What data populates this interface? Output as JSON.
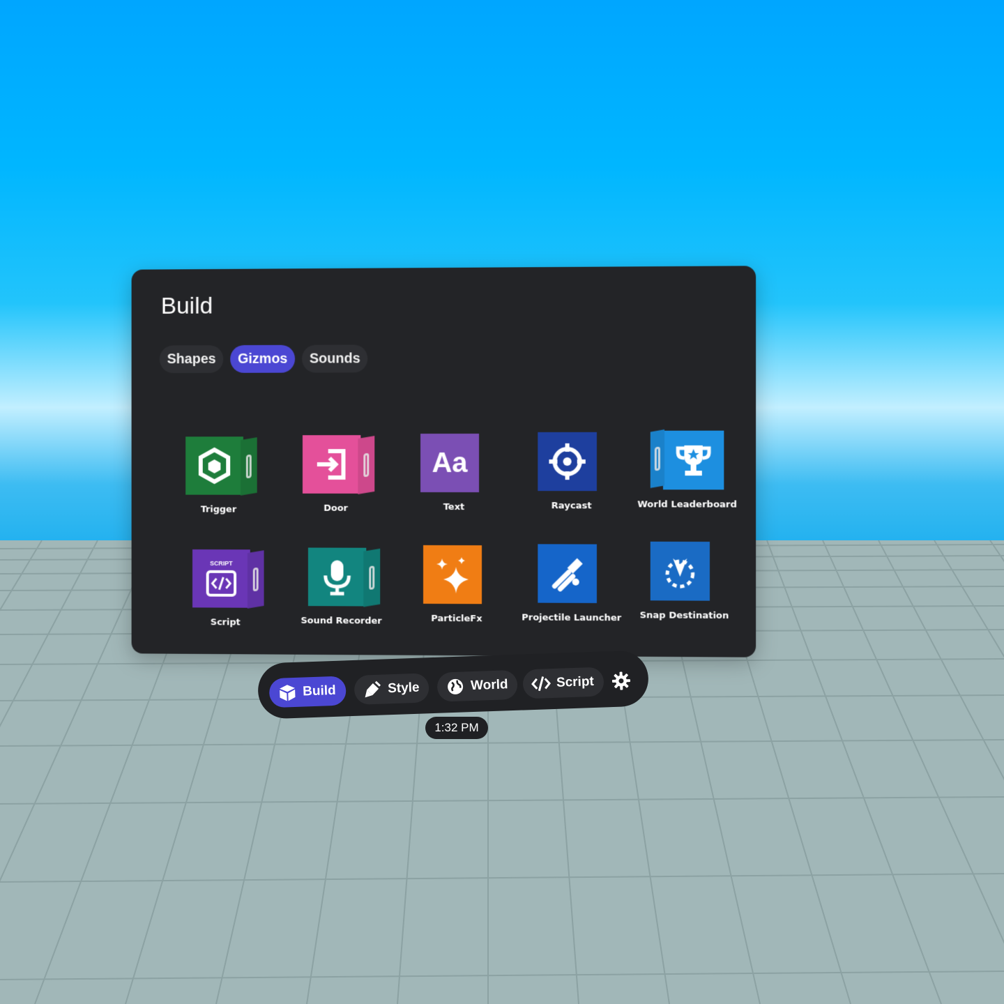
{
  "panel": {
    "title": "Build",
    "tabs": [
      {
        "label": "Shapes",
        "active": false
      },
      {
        "label": "Gizmos",
        "active": true
      },
      {
        "label": "Sounds",
        "active": false
      }
    ]
  },
  "gizmos": [
    {
      "label": "Trigger",
      "color": "#1e7d3b",
      "icon": "trigger-icon"
    },
    {
      "label": "Door",
      "color": "#e4509a",
      "icon": "door-icon"
    },
    {
      "label": "Text",
      "color": "#7b4fb4",
      "icon": "text-icon",
      "glyph": "Aa"
    },
    {
      "label": "Raycast",
      "color": "#1e3f9e",
      "icon": "crosshair-icon"
    },
    {
      "label": "World Leaderboard",
      "color": "#1d8fe0",
      "icon": "trophy-icon"
    },
    {
      "label": "Script",
      "color": "#6a36b6",
      "icon": "code-icon",
      "caption": "SCRIPT"
    },
    {
      "label": "Sound Recorder",
      "color": "#12857f",
      "icon": "microphone-icon"
    },
    {
      "label": "ParticleFx",
      "color": "#f07d14",
      "icon": "sparkle-icon"
    },
    {
      "label": "Projectile Launcher",
      "color": "#1565c9",
      "icon": "launcher-icon"
    },
    {
      "label": "Snap Destination",
      "color": "#1a6bc4",
      "icon": "snap-destination-icon"
    }
  ],
  "toolbar": {
    "buttons": [
      {
        "label": "Build",
        "icon": "cube-icon",
        "active": true
      },
      {
        "label": "Style",
        "icon": "brush-icon",
        "active": false
      },
      {
        "label": "World",
        "icon": "globe-icon",
        "active": false
      },
      {
        "label": "Script",
        "icon": "code-icon",
        "active": false
      }
    ],
    "settings_icon": "gear-icon"
  },
  "clock": "1:32 PM",
  "colors": {
    "accent": "#4b47d3",
    "panel": "#232427"
  }
}
